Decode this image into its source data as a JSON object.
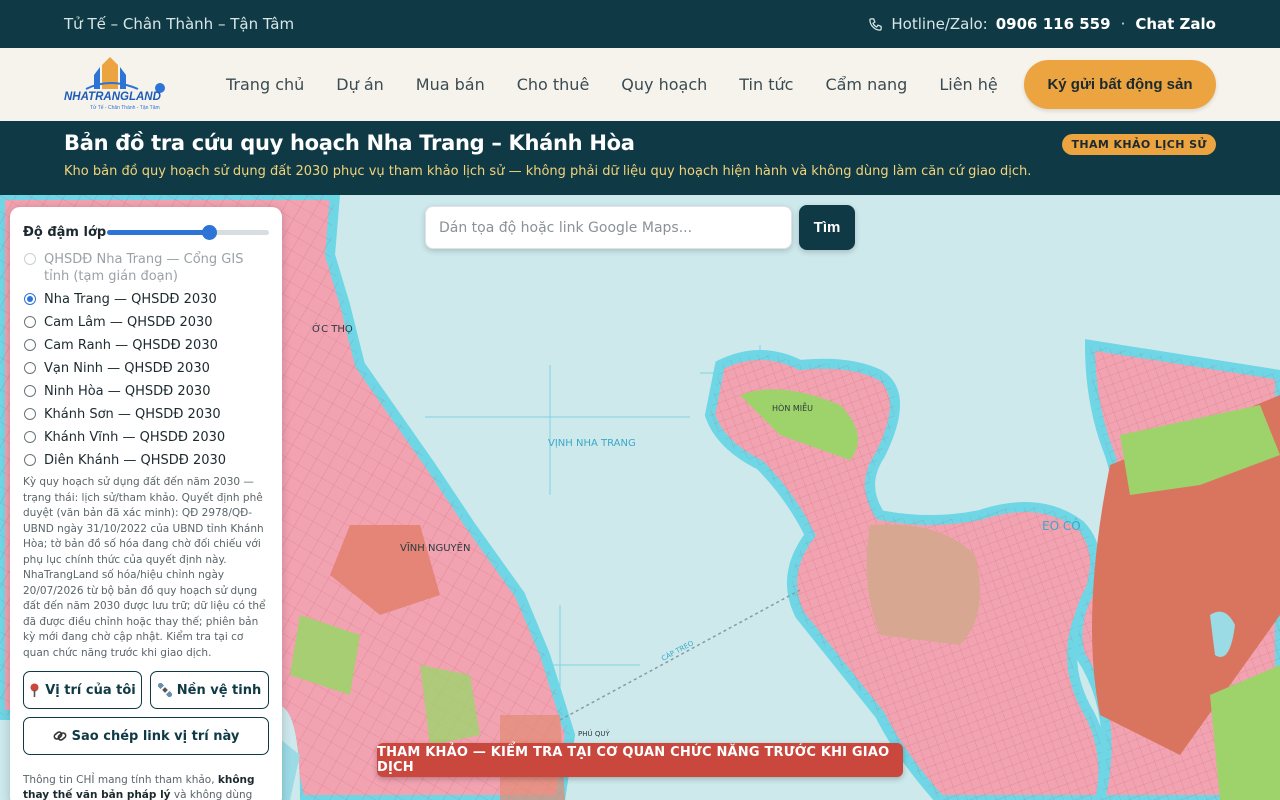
{
  "topbar": {
    "slogan": "Tử Tế – Chân Thành – Tận Tâm",
    "hotline_label": "Hotline/Zalo:",
    "hotline_number": "0906 116 559",
    "separator": "·",
    "chat_label": "Chat Zalo"
  },
  "logo": {
    "brand": "NHATRANGLAND",
    "tagline": "Tử Tế - Chân Thành - Tận Tâm"
  },
  "nav": {
    "items": [
      "Trang chủ",
      "Dự án",
      "Mua bán",
      "Cho thuê",
      "Quy hoạch",
      "Tin tức",
      "Cẩm nang",
      "Liên hệ"
    ],
    "cta_label": "Ký gửi bất động sản"
  },
  "band": {
    "title": "Bản đồ tra cứu quy hoạch Nha Trang – Khánh Hòa",
    "subtitle": "Kho bản đồ quy hoạch sử dụng đất 2030 phục vụ tham khảo lịch sử — không phải dữ liệu quy hoạch hiện hành và không dùng làm căn cứ giao dịch.",
    "badge": "THAM KHẢO LỊCH SỬ"
  },
  "search": {
    "placeholder": "Dán tọa độ hoặc link Google Maps...",
    "button_label": "Tìm"
  },
  "panel": {
    "opacity_label": "Độ đậm lớp",
    "opacity_value": 0.63,
    "layers": [
      {
        "label": "QHSDĐ Nha Trang — Cổng GIS tỉnh (tạm gián đoạn)",
        "state": "disabled"
      },
      {
        "label": "Nha Trang — QHSDĐ 2030",
        "state": "checked"
      },
      {
        "label": "Cam Lâm — QHSDĐ 2030",
        "state": ""
      },
      {
        "label": "Cam Ranh — QHSDĐ 2030",
        "state": ""
      },
      {
        "label": "Vạn Ninh — QHSDĐ 2030",
        "state": ""
      },
      {
        "label": "Ninh Hòa — QHSDĐ 2030",
        "state": ""
      },
      {
        "label": "Khánh Sơn — QHSDĐ 2030",
        "state": ""
      },
      {
        "label": "Khánh Vĩnh — QHSDĐ 2030",
        "state": ""
      },
      {
        "label": "Diên Khánh — QHSDĐ 2030",
        "state": ""
      }
    ],
    "description": "Kỳ quy hoạch sử dụng đất đến năm 2030 — trạng thái: lịch sử/tham khảo. Quyết định phê duyệt (văn bản đã xác minh): QĐ 2978/QĐ-UBND ngày 31/10/2022 của UBND tỉnh Khánh Hòa; tờ bản đồ số hóa đang chờ đối chiếu với phụ lục chính thức của quyết định này. NhaTrangLand số hóa/hiệu chỉnh ngày 20/07/2026 từ bộ bản đồ quy hoạch sử dụng đất đến năm 2030 được lưu trữ; dữ liệu có thể đã được điều chỉnh hoặc thay thế; phiên bản kỳ mới đang chờ cập nhật. Kiểm tra tại cơ quan chức năng trước khi giao dịch.",
    "locate_label": "Vị trí của tôi",
    "satellite_label": "Nền vệ tinh",
    "copy_link_label": "Sao chép link vị trí này",
    "note_prefix": "Thông tin CHỈ mang tính tham khảo, ",
    "note_bold": "không thay thế văn bản pháp lý",
    "note_suffix": " và không dùng làm căn cứ giao dịch."
  },
  "map": {
    "labels": {
      "bay": "VỊNH NHA TRANG",
      "vinh_nguyen": "VĨNH NGUYÊN",
      "phuoc_tho": "ỚC THỌ",
      "hon_mieu": "HÒN MIỄU",
      "eo_co": "EO CÒ",
      "phu_quy": "PHÚ QUÝ",
      "cable": "CÁP TREO"
    }
  },
  "warning": "THAM KHẢO — KIỂM TRA TẠI CƠ QUAN CHỨC NĂNG TRƯỚC KHI GIAO DỊCH",
  "colors": {
    "dark": "#0f3a45",
    "accent": "#eba43f",
    "warning": "#c9473d",
    "land_pink": "#f2a3b2",
    "land_salmon": "#d9755f",
    "green": "#9ed36b",
    "water": "#cde9ec"
  }
}
